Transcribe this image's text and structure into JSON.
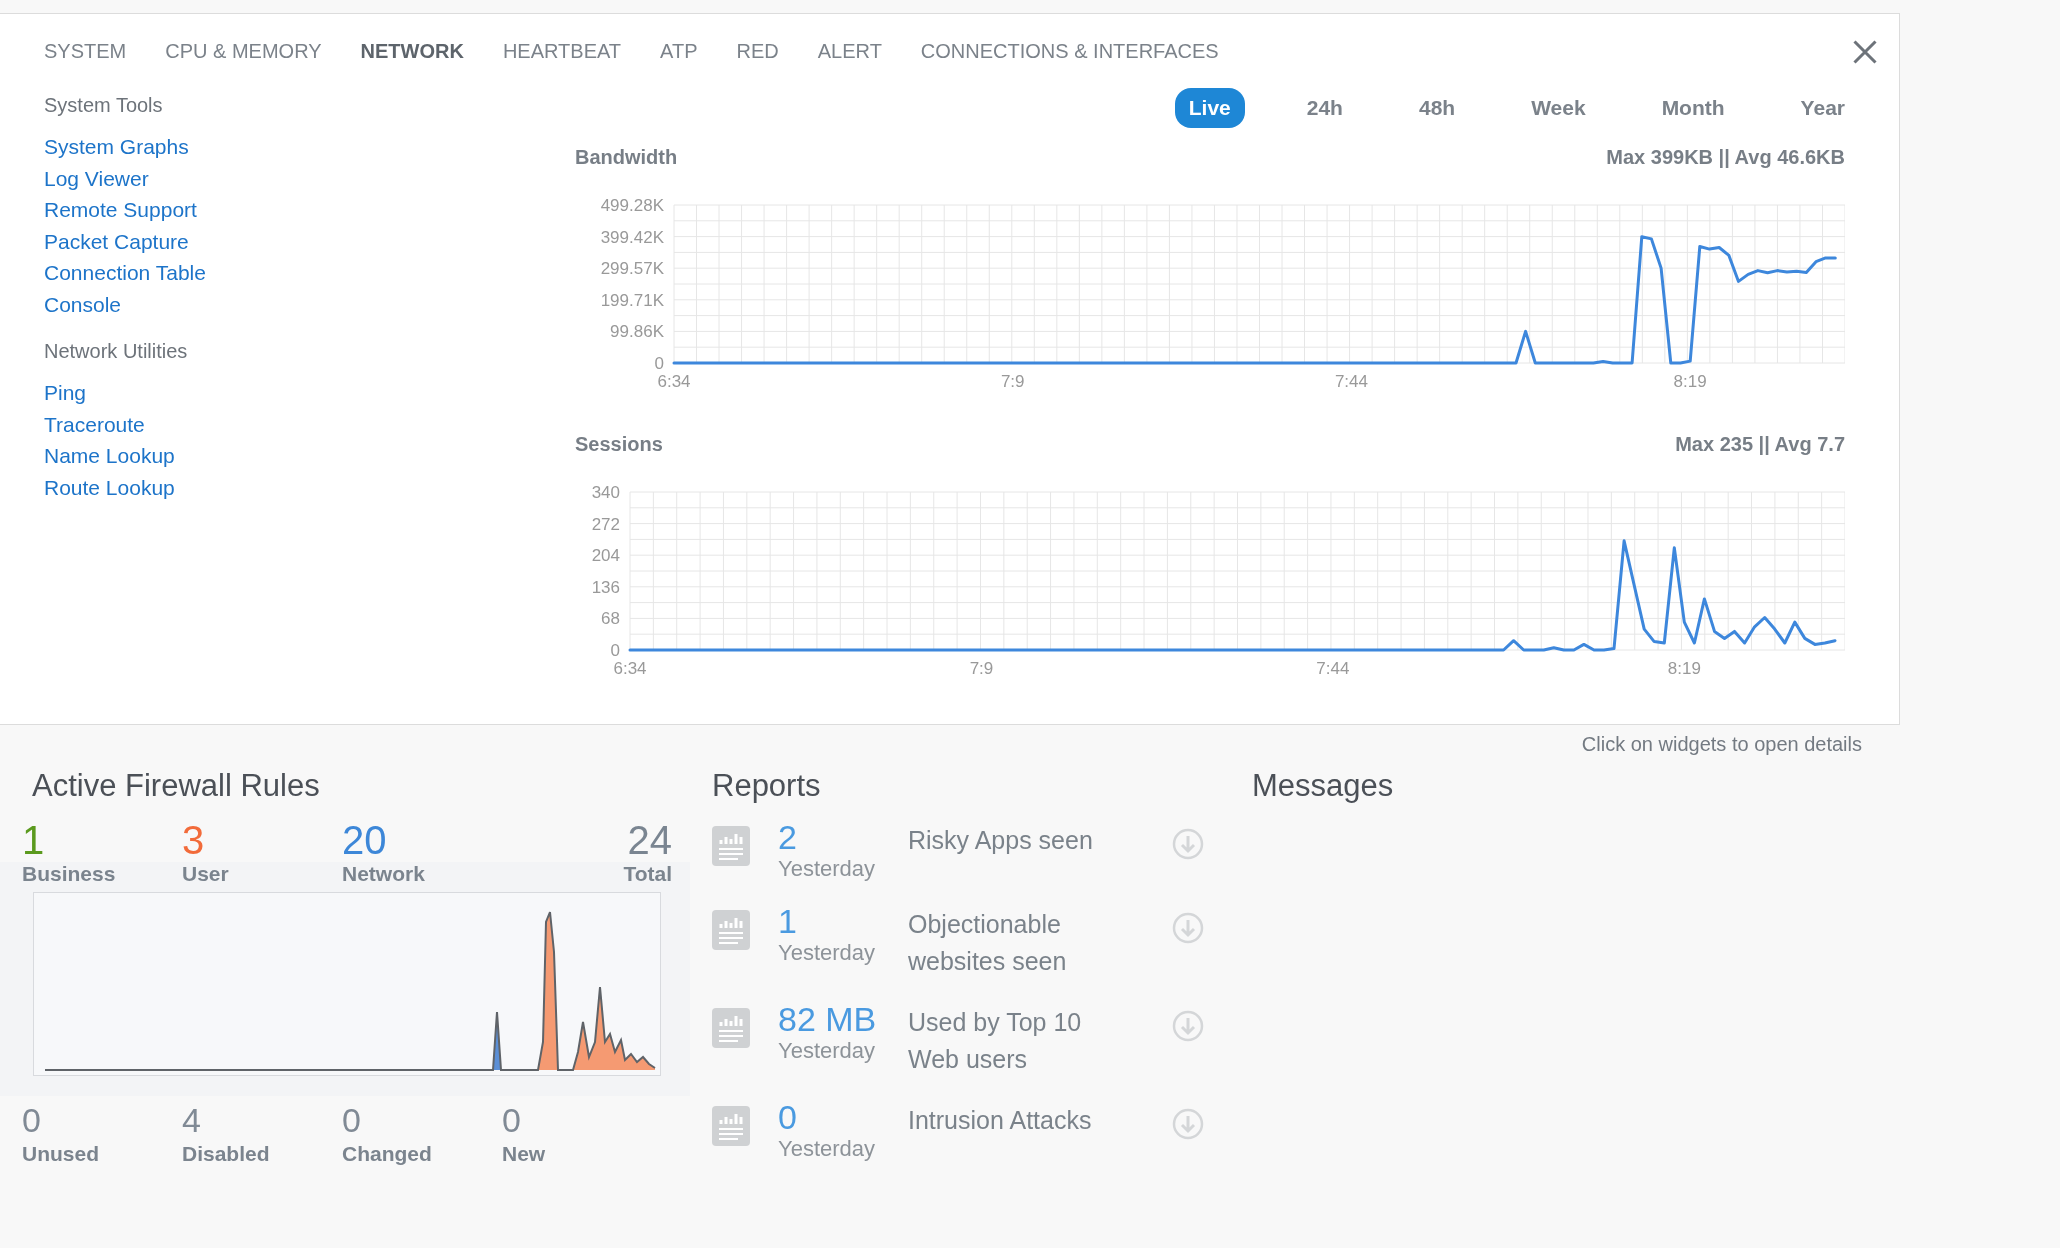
{
  "tabs": [
    {
      "label": "SYSTEM",
      "selected": false
    },
    {
      "label": "CPU & MEMORY",
      "selected": false
    },
    {
      "label": "NETWORK",
      "selected": true
    },
    {
      "label": "HEARTBEAT",
      "selected": false
    },
    {
      "label": "ATP",
      "selected": false
    },
    {
      "label": "RED",
      "selected": false
    },
    {
      "label": "ALERT",
      "selected": false
    },
    {
      "label": "CONNECTIONS & INTERFACES",
      "selected": false
    }
  ],
  "sidebar": {
    "sections": [
      {
        "heading": "System Tools",
        "links": [
          "System Graphs",
          "Log Viewer",
          "Remote Support",
          "Packet Capture",
          "Connection Table",
          "Console"
        ]
      },
      {
        "heading": "Network Utilities",
        "links": [
          "Ping",
          "Traceroute",
          "Name Lookup",
          "Route Lookup"
        ]
      }
    ]
  },
  "time_ranges": [
    {
      "label": "Live",
      "selected": true
    },
    {
      "label": "24h",
      "selected": false
    },
    {
      "label": "48h",
      "selected": false
    },
    {
      "label": "Week",
      "selected": false
    },
    {
      "label": "Month",
      "selected": false
    },
    {
      "label": "Year",
      "selected": false
    }
  ],
  "charts": [
    {
      "summary": "Max 399KB || Avg 46.6KB",
      "chart_data": {
        "type": "line",
        "title": "Bandwidth",
        "grid": true,
        "xlim": [
          394,
          515
        ],
        "ylim": [
          0,
          499.28
        ],
        "yticks": [
          {
            "value": 0,
            "label": "0"
          },
          {
            "value": 99.86,
            "label": "99.86K"
          },
          {
            "value": 199.71,
            "label": "199.71K"
          },
          {
            "value": 299.57,
            "label": "299.57K"
          },
          {
            "value": 399.42,
            "label": "399.42K"
          },
          {
            "value": 499.28,
            "label": "499.28K"
          }
        ],
        "xticks": [
          {
            "value": 394,
            "label": "6:34"
          },
          {
            "value": 429,
            "label": "7:9"
          },
          {
            "value": 464,
            "label": "7:44"
          },
          {
            "value": 499,
            "label": "8:19"
          }
        ],
        "x": [
          394,
          395,
          396,
          397,
          398,
          399,
          400,
          401,
          402,
          403,
          404,
          405,
          406,
          407,
          408,
          409,
          410,
          411,
          412,
          413,
          414,
          415,
          416,
          417,
          418,
          419,
          420,
          421,
          422,
          423,
          424,
          425,
          426,
          427,
          428,
          429,
          430,
          431,
          432,
          433,
          434,
          435,
          436,
          437,
          438,
          439,
          440,
          441,
          442,
          443,
          444,
          445,
          446,
          447,
          448,
          449,
          450,
          451,
          452,
          453,
          454,
          455,
          456,
          457,
          458,
          459,
          460,
          461,
          462,
          463,
          464,
          465,
          466,
          467,
          468,
          469,
          470,
          471,
          472,
          473,
          474,
          475,
          476,
          477,
          478,
          479,
          480,
          481,
          482,
          483,
          484,
          485,
          486,
          487,
          488,
          489,
          490,
          491,
          492,
          493,
          494,
          495,
          496,
          497,
          498,
          499,
          500,
          501,
          502,
          503,
          504,
          505,
          506,
          507,
          508,
          509,
          510,
          511,
          512,
          513,
          514
        ],
        "values": [
          0,
          0,
          0,
          0,
          0,
          0,
          0,
          0,
          0,
          0,
          0,
          0,
          0,
          0,
          0,
          0,
          0,
          0,
          0,
          0,
          0,
          0,
          0,
          0,
          0,
          0,
          0,
          0,
          0,
          0,
          0,
          0,
          0,
          0,
          0,
          0,
          0,
          0,
          0,
          0,
          0,
          0,
          0,
          0,
          0,
          0,
          0,
          0,
          0,
          0,
          0,
          0,
          0,
          0,
          0,
          0,
          0,
          0,
          0,
          0,
          0,
          0,
          0,
          0,
          0,
          0,
          0,
          0,
          0,
          0,
          0,
          0,
          0,
          0,
          0,
          0,
          0,
          0,
          0,
          0,
          0,
          0,
          0,
          0,
          0,
          0,
          0,
          0,
          100,
          0,
          0,
          0,
          0,
          0,
          0,
          0,
          5,
          0,
          0,
          0,
          399,
          392,
          300,
          0,
          0,
          6,
          368,
          360,
          365,
          340,
          258,
          280,
          292,
          285,
          292,
          288,
          290,
          286,
          320,
          332,
          332
        ]
      }
    },
    {
      "summary": "Max 235 || Avg 7.7",
      "chart_data": {
        "type": "line",
        "title": "Sessions",
        "grid": true,
        "xlim": [
          394,
          515
        ],
        "ylim": [
          0,
          340
        ],
        "yticks": [
          {
            "value": 0,
            "label": "0"
          },
          {
            "value": 68,
            "label": "68"
          },
          {
            "value": 136,
            "label": "136"
          },
          {
            "value": 204,
            "label": "204"
          },
          {
            "value": 272,
            "label": "272"
          },
          {
            "value": 340,
            "label": "340"
          }
        ],
        "xticks": [
          {
            "value": 394,
            "label": "6:34"
          },
          {
            "value": 429,
            "label": "7:9"
          },
          {
            "value": 464,
            "label": "7:44"
          },
          {
            "value": 499,
            "label": "8:19"
          }
        ],
        "x": [
          394,
          395,
          396,
          397,
          398,
          399,
          400,
          401,
          402,
          403,
          404,
          405,
          406,
          407,
          408,
          409,
          410,
          411,
          412,
          413,
          414,
          415,
          416,
          417,
          418,
          419,
          420,
          421,
          422,
          423,
          424,
          425,
          426,
          427,
          428,
          429,
          430,
          431,
          432,
          433,
          434,
          435,
          436,
          437,
          438,
          439,
          440,
          441,
          442,
          443,
          444,
          445,
          446,
          447,
          448,
          449,
          450,
          451,
          452,
          453,
          454,
          455,
          456,
          457,
          458,
          459,
          460,
          461,
          462,
          463,
          464,
          465,
          466,
          467,
          468,
          469,
          470,
          471,
          472,
          473,
          474,
          475,
          476,
          477,
          478,
          479,
          480,
          481,
          482,
          483,
          484,
          485,
          486,
          487,
          488,
          489,
          490,
          491,
          492,
          493,
          494,
          495,
          496,
          497,
          498,
          499,
          500,
          501,
          502,
          503,
          504,
          505,
          506,
          507,
          508,
          509,
          510,
          511,
          512,
          513,
          514
        ],
        "values": [
          0,
          0,
          0,
          0,
          0,
          0,
          0,
          0,
          0,
          0,
          0,
          0,
          0,
          0,
          0,
          0,
          0,
          0,
          0,
          0,
          0,
          0,
          0,
          0,
          0,
          0,
          0,
          0,
          0,
          0,
          0,
          0,
          0,
          0,
          0,
          0,
          0,
          0,
          0,
          0,
          0,
          0,
          0,
          0,
          0,
          0,
          0,
          0,
          0,
          0,
          0,
          0,
          0,
          0,
          0,
          0,
          0,
          0,
          0,
          0,
          0,
          0,
          0,
          0,
          0,
          0,
          0,
          0,
          0,
          0,
          0,
          0,
          0,
          0,
          0,
          0,
          0,
          0,
          0,
          0,
          0,
          0,
          0,
          0,
          0,
          0,
          0,
          0,
          20,
          0,
          0,
          0,
          5,
          0,
          0,
          12,
          0,
          0,
          3,
          235,
          140,
          45,
          18,
          15,
          220,
          60,
          15,
          110,
          40,
          25,
          40,
          15,
          50,
          70,
          45,
          15,
          60,
          25,
          12,
          15,
          20
        ]
      }
    }
  ],
  "hint": "Click on widgets to open details",
  "firewall": {
    "title": "Active Firewall Rules",
    "counts": [
      {
        "value": "1",
        "label": "Business",
        "color": "#5b9a1e"
      },
      {
        "value": "3",
        "label": "User",
        "color": "#f26b3a"
      },
      {
        "value": "20",
        "label": "Network",
        "color": "#3d87d8"
      },
      {
        "value": "24",
        "label": "Total",
        "color": "#7a8591"
      }
    ],
    "stats": [
      {
        "value": "0",
        "label": "Unused"
      },
      {
        "value": "4",
        "label": "Disabled"
      },
      {
        "value": "0",
        "label": "Changed"
      },
      {
        "value": "0",
        "label": "New"
      }
    ]
  },
  "reports": {
    "title": "Reports",
    "items": [
      {
        "value": "2",
        "period": "Yesterday",
        "description": "Risky Apps seen"
      },
      {
        "value": "1",
        "period": "Yesterday",
        "description": "Objectionable websites seen"
      },
      {
        "value": "82 MB",
        "period": "Yesterday",
        "description": "Used by Top 10 Web users"
      },
      {
        "value": "0",
        "period": "Yesterday",
        "description": "Intrusion Attacks"
      }
    ]
  },
  "messages": {
    "title": "Messages"
  }
}
